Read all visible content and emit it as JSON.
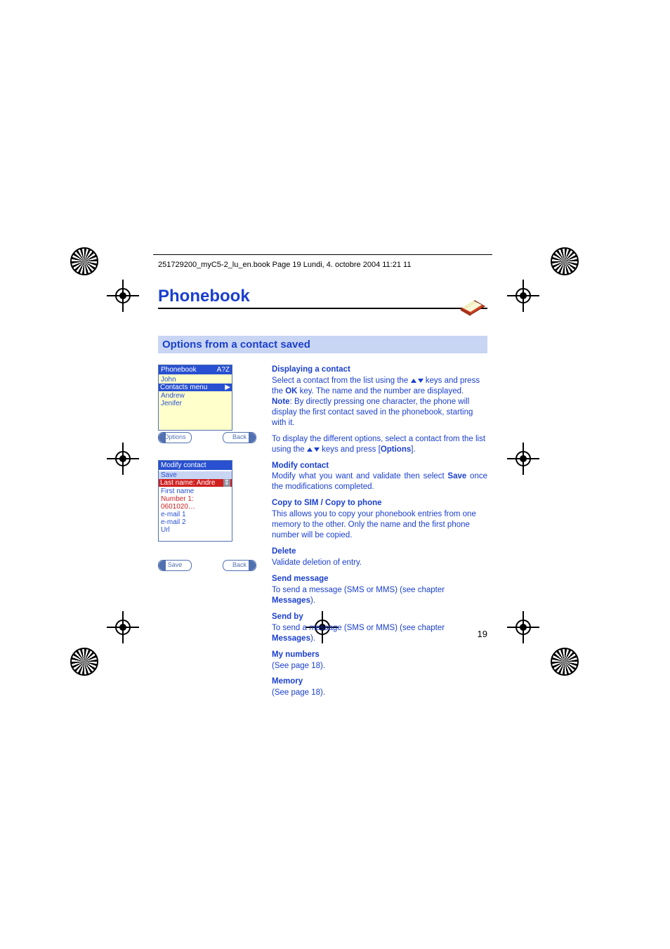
{
  "header": {
    "doc_info": "251729200_myC5-2_lu_en.book  Page 19  Lundi, 4. octobre 2004  11:21 11"
  },
  "page": {
    "title": "Phonebook",
    "section_title": "Options from a contact saved",
    "page_number": "19"
  },
  "screen1": {
    "title_left": "Phonebook",
    "title_right": "A?Z",
    "item1": "John",
    "item2_left": "Contacts menu",
    "item2_right": "▶",
    "item3": "Andrew",
    "item4": "Jenifer",
    "soft_left": "Options",
    "soft_right": "Back"
  },
  "screen2": {
    "title": "Modify contact",
    "row1": "Save",
    "row2": "Last name: Andre",
    "row2_arrow": "⇕",
    "row3": "First name",
    "row4": "Number 1: 0601020…",
    "row5": "e-mail 1",
    "row6": "e-mail 2",
    "row7": "Url",
    "soft_left": "Save",
    "soft_right": "Back"
  },
  "body": {
    "displaying": {
      "heading": "Displaying a contact",
      "line1a": "Select a contact from the list using the ",
      "line1b": " keys and press the ",
      "ok": "OK",
      "line1c": " key. The name and the number are displayed.",
      "note_label": "Note",
      "note_text": ": By directly pressing one character, the phone will display the first contact saved in the phonebook, starting with it.",
      "line2a": "To display the different options, select a contact from the list using the ",
      "line2b": " keys and press [",
      "options": "Options",
      "line2c": "]."
    },
    "modify": {
      "heading": "Modify contact",
      "text_a": "Modify what you want and validate then select ",
      "save": "Save",
      "text_b": " once the modifications completed."
    },
    "copy": {
      "heading": "Copy to SIM / Copy to phone",
      "text": "This allows you to copy your phonebook entries from one memory to the other. Only the name and the first phone number will be copied."
    },
    "delete": {
      "heading": "Delete",
      "text": "Validate deletion of entry."
    },
    "sendmsg": {
      "heading": "Send message",
      "text_a": "To send a message (SMS or MMS) (see chapter ",
      "messages": "Messages",
      "text_b": ")."
    },
    "sendby": {
      "heading": "Send by",
      "text_a": "To send a message (SMS or MMS) (see chapter ",
      "messages": "Messages",
      "text_b": ")."
    },
    "mynumbers": {
      "heading": "My numbers",
      "text": "(See page 18)."
    },
    "memory": {
      "heading": "Memory",
      "text": "(See page 18)."
    }
  }
}
